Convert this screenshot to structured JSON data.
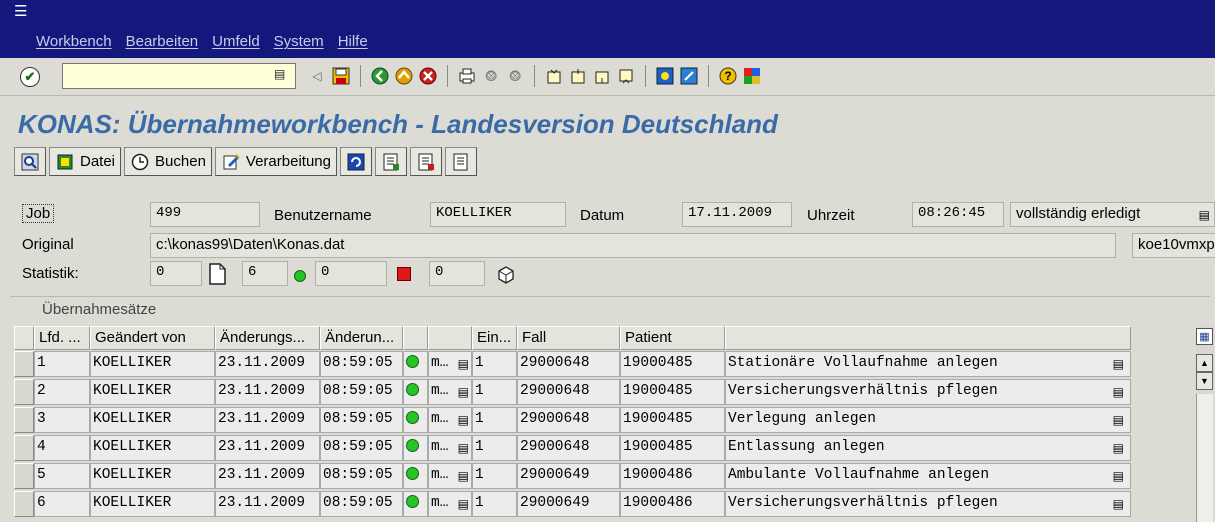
{
  "window": {
    "menu": [
      "Workbench",
      "Bearbeiten",
      "Umfeld",
      "System",
      "Hilfe"
    ]
  },
  "toolbar": {
    "command_value": "",
    "icons": [
      "enter-icon",
      "save-icon",
      "back-icon",
      "exit-icon",
      "cancel-icon",
      "print-icon",
      "find-icon",
      "find-next-icon",
      "first-page-icon",
      "prev-page-icon",
      "next-page-icon",
      "last-page-icon",
      "new-session-icon",
      "shortcut-icon",
      "help-icon",
      "layout-icon"
    ]
  },
  "page": {
    "title": "KONAS: Übernahmeworkbench - Landesversion Deutschland"
  },
  "app_toolbar": {
    "datei": "Datei",
    "buchen": "Buchen",
    "verarbeitung": "Verarbeitung"
  },
  "header": {
    "job_label": "Job",
    "job_value": "499",
    "benutzername_label": "Benutzername",
    "benutzername_value": "KOELLIKER",
    "datum_label": "Datum",
    "datum_value": "17.11.2009",
    "uhrzeit_label": "Uhrzeit",
    "uhrzeit_value": "08:26:45",
    "status_value": "vollständig erledigt",
    "original_label": "Original",
    "original_value": "c:\\konas99\\Daten\\Konas.dat",
    "original_right": "koe10vmxp",
    "statistik_label": "Statistik:",
    "stat_total": "0",
    "stat_docs": "6",
    "stat_green": "0",
    "stat_red": "0"
  },
  "section": {
    "label": "Übernahmesätze"
  },
  "table": {
    "columns": [
      "Lfd. ...",
      "Geändert von",
      "Änderungs...",
      "Änderun...",
      "",
      "",
      "Ein...",
      "Fall",
      "Patient",
      ""
    ],
    "rows": [
      {
        "lfd": "1",
        "von": "KOELLIKER",
        "datum": "23.11.2009",
        "zeit": "08:59:05",
        "m": "m…",
        "ein": "1",
        "fall": "29000648",
        "patient": "19000485",
        "text": "Stationäre Vollaufnahme anlegen"
      },
      {
        "lfd": "2",
        "von": "KOELLIKER",
        "datum": "23.11.2009",
        "zeit": "08:59:05",
        "m": "m…",
        "ein": "1",
        "fall": "29000648",
        "patient": "19000485",
        "text": "Versicherungsverhältnis pflegen"
      },
      {
        "lfd": "3",
        "von": "KOELLIKER",
        "datum": "23.11.2009",
        "zeit": "08:59:05",
        "m": "m…",
        "ein": "1",
        "fall": "29000648",
        "patient": "19000485",
        "text": "Verlegung anlegen"
      },
      {
        "lfd": "4",
        "von": "KOELLIKER",
        "datum": "23.11.2009",
        "zeit": "08:59:05",
        "m": "m…",
        "ein": "1",
        "fall": "29000648",
        "patient": "19000485",
        "text": "Entlassung anlegen"
      },
      {
        "lfd": "5",
        "von": "KOELLIKER",
        "datum": "23.11.2009",
        "zeit": "08:59:05",
        "m": "m…",
        "ein": "1",
        "fall": "29000649",
        "patient": "19000486",
        "text": "Ambulante Vollaufnahme anlegen"
      },
      {
        "lfd": "6",
        "von": "KOELLIKER",
        "datum": "23.11.2009",
        "zeit": "08:59:05",
        "m": "m…",
        "ein": "1",
        "fall": "29000649",
        "patient": "19000486",
        "text": "Versicherungsverhältnis pflegen"
      }
    ]
  },
  "colors": {
    "menubar": "#14187c",
    "title": "#3a6ba8",
    "status_green": "#26c526",
    "status_red": "#e01818"
  }
}
